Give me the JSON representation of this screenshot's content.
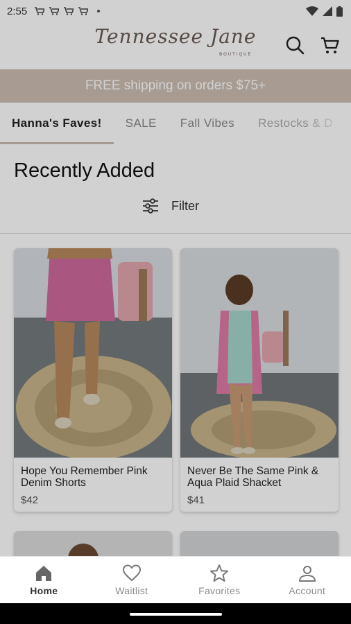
{
  "status_bar": {
    "time": "2:55"
  },
  "header": {
    "logo_text": "Tennessee Jane",
    "logo_subtext": "BOUTIQUE"
  },
  "promo": {
    "text": "FREE shipping on orders $75+"
  },
  "tabs": [
    {
      "label": "Hanna's Faves!",
      "active": true
    },
    {
      "label": "SALE"
    },
    {
      "label": "Fall Vibes"
    },
    {
      "label": "Restocks & D"
    }
  ],
  "section": {
    "title": "Recently Added",
    "filter_label": "Filter"
  },
  "products": [
    {
      "name": "Hope You Remember Pink Denim Shorts",
      "price": "$42"
    },
    {
      "name": "Never Be The Same Pink & Aqua Plaid Shacket",
      "price": "$41"
    }
  ],
  "bottom_nav": [
    {
      "label": "Home",
      "icon": "home-icon",
      "active": true
    },
    {
      "label": "Waitlist",
      "icon": "heart-icon"
    },
    {
      "label": "Favorites",
      "icon": "star-icon"
    },
    {
      "label": "Account",
      "icon": "person-icon"
    }
  ],
  "colors": {
    "promo_bg": "#ccbdb3",
    "accent": "#ccbdb3",
    "logo": "#6b5b55"
  }
}
